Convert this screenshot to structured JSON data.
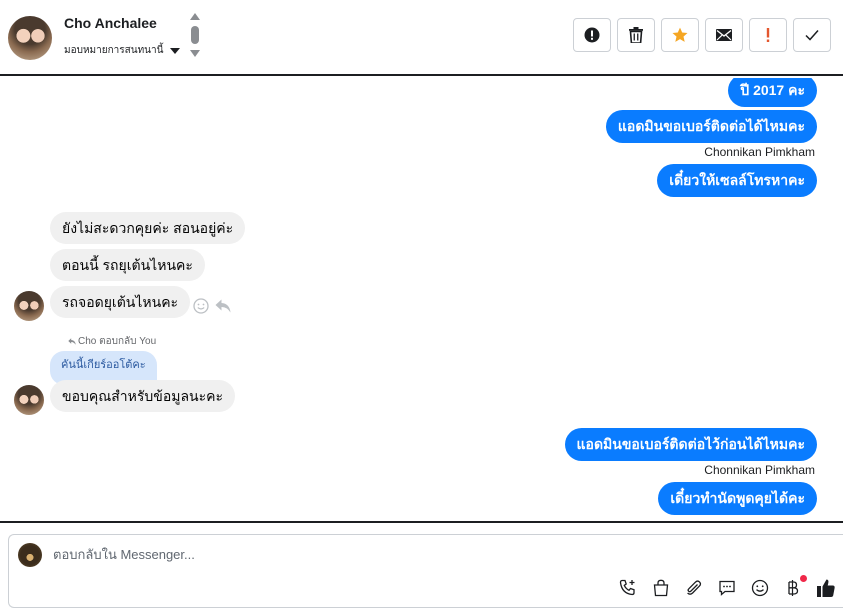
{
  "header": {
    "contact_name": "Cho Anchalee",
    "assign_label": "มอบหมายการสนทนานี้",
    "actions": [
      {
        "name": "mark-spam",
        "icon": "alert-circle-icon"
      },
      {
        "name": "delete",
        "icon": "trash-icon"
      },
      {
        "name": "star",
        "icon": "star-icon",
        "color": "#f5a623"
      },
      {
        "name": "mark-unread",
        "icon": "envelope-icon"
      },
      {
        "name": "follow-up",
        "icon": "exclamation-icon",
        "color": "#e4572e"
      },
      {
        "name": "mark-done",
        "icon": "check-icon"
      }
    ]
  },
  "messages": {
    "out_1": "ปี 2017 คะ",
    "out_2": "แอดมินขอเบอร์ติดต่อได้ไหมคะ",
    "sender_1": "Chonnikan Pimkham",
    "out_3": "เดี๋ยวให้เซลล์โทรหาคะ",
    "in_1": "ยังไม่สะดวกคุยค่ะ สอนอยู่ค่ะ",
    "in_2": "ตอนนี้ รถยุเต้นไหนคะ",
    "in_3": "รถจอดยุเต้นไหนคะ",
    "reply_note": "Cho ตอบกลับ You",
    "quoted": "คันนี้เกียร์ออโต้คะ",
    "in_4": "ขอบคุณสำหรับข้อมูลนะคะ",
    "out_4": "แอดมินขอเบอร์ติดต่อไว้ก่อนได้ไหมคะ",
    "sender_2": "Chonnikan Pimkham",
    "out_5": "เดี๋ยวทำนัดพูดคุยได้คะ"
  },
  "composer": {
    "placeholder": "ตอบกลับใน Messenger..."
  },
  "colors": {
    "outgoing_bubble": "#0a7cff",
    "incoming_bubble": "#f0f0f0",
    "quoted_bubble": "#d6e6fb",
    "notification_dot": "#f02849"
  }
}
